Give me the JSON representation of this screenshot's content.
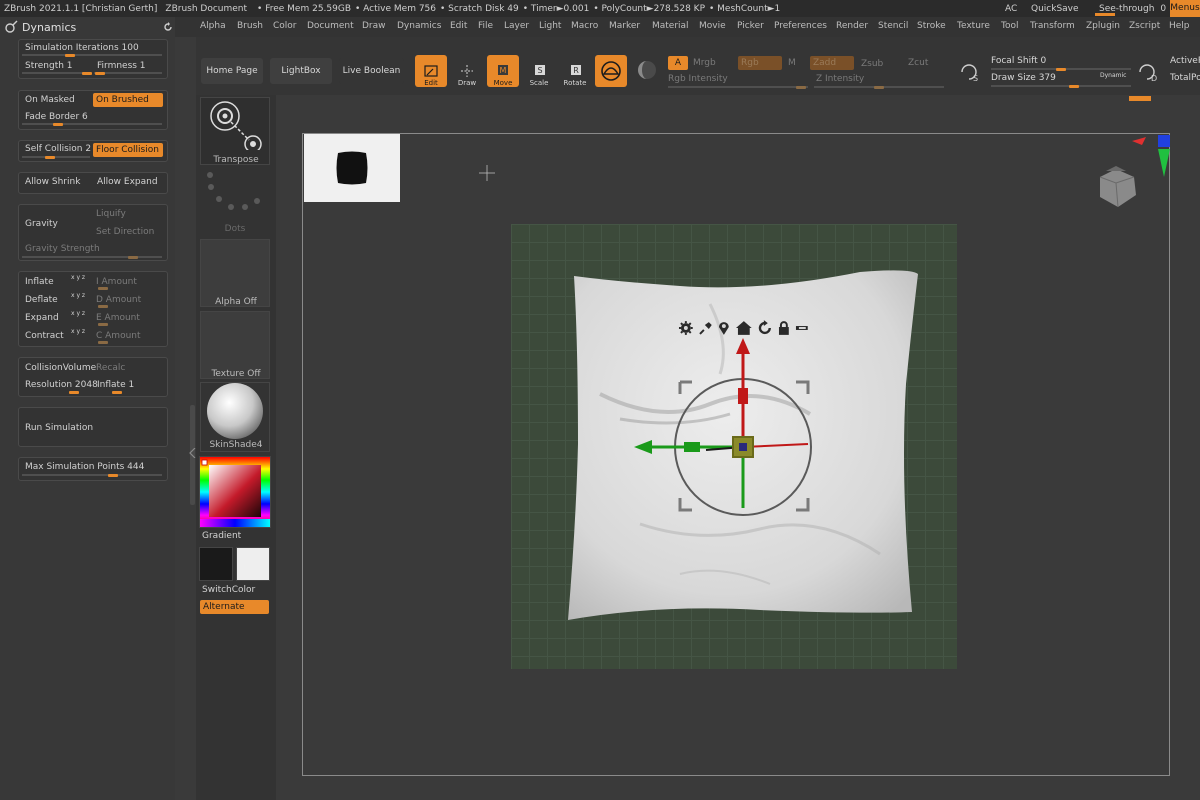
{
  "titlebar": {
    "app": "ZBrush 2021.1.1 [Christian Gerth]",
    "document": "ZBrush Document",
    "free_mem": "• Free Mem 25.59GB",
    "active_mem": "• Active Mem 756",
    "scratch": "• Scratch Disk 49",
    "timer": "• Timer►0.001",
    "polycount": "• PolyCount►278.528 KP",
    "meshcount": "• MeshCount►1",
    "ac": "AC",
    "quicksave": "QuickSave",
    "seethrough": "See-through",
    "seethrough_value": "0",
    "menus": "Menus"
  },
  "menubar": [
    "Alpha",
    "Brush",
    "Color",
    "Document",
    "Draw",
    "Dynamics",
    "Edit",
    "File",
    "Layer",
    "Light",
    "Macro",
    "Marker",
    "Material",
    "Movie",
    "Picker",
    "Preferences",
    "Render",
    "Stencil",
    "Stroke",
    "Texture",
    "Tool",
    "Transform",
    "Zplugin",
    "Zscript",
    "Help"
  ],
  "dynamics": {
    "title": "Dynamics",
    "sim_iterations": "Simulation Iterations 100",
    "strength": "Strength 1",
    "firmness": "Firmness 1",
    "on_masked": "On Masked",
    "on_brushed": "On Brushed",
    "fade_border": "Fade Border 6",
    "self_collision": "Self Collision 2",
    "floor_collision": "Floor Collision",
    "allow_shrink": "Allow Shrink",
    "allow_expand": "Allow Expand",
    "gravity": "Gravity",
    "liquify": "Liquify",
    "set_direction": "Set Direction",
    "gravity_strength": "Gravity Strength",
    "inflate": "Inflate",
    "deflate": "Deflate",
    "expand": "Expand",
    "contract": "Contract",
    "xyz": "x y z",
    "i_amount": "I Amount",
    "d_amount": "D Amount",
    "e_amount": "E Amount",
    "c_amount": "C Amount",
    "collision_volume": "CollisionVolume",
    "recalc": "Recalc",
    "resolution": "Resolution 2048",
    "inflate_val": "Inflate 1",
    "run_simulation": "Run Simulation",
    "max_sim_points": "Max Simulation Points 444"
  },
  "shelf": {
    "home_page": "Home Page",
    "lightbox": "LightBox",
    "live_boolean": "Live Boolean",
    "edit": "Edit",
    "draw": "Draw",
    "move": "Move",
    "scale": "Scale",
    "rotate": "Rotate",
    "a": "A",
    "mrgb": "Mrgb",
    "rgb": "Rgb",
    "m": "M",
    "zadd": "Zadd",
    "zsub": "Zsub",
    "zcut": "Zcut",
    "rgb_intensity": "Rgb Intensity",
    "z_intensity": "Z Intensity",
    "focal_shift": "Focal Shift 0",
    "draw_size": "Draw Size 379",
    "dynamic": "Dynamic",
    "s_label": "S",
    "d_label": "D",
    "activepoints": "ActiveP",
    "totalpoints": "TotalPo"
  },
  "thumbs": {
    "transpose": "Transpose",
    "dots": "Dots",
    "alpha_off": "Alpha Off",
    "texture_off": "Texture Off",
    "material": "SkinShade4",
    "gradient": "Gradient",
    "switchcolor": "SwitchColor",
    "alternate": "Alternate"
  },
  "colors": {
    "accent": "#e8892a",
    "bg": "#3a3a3a",
    "floor": "#3c4a3a"
  }
}
